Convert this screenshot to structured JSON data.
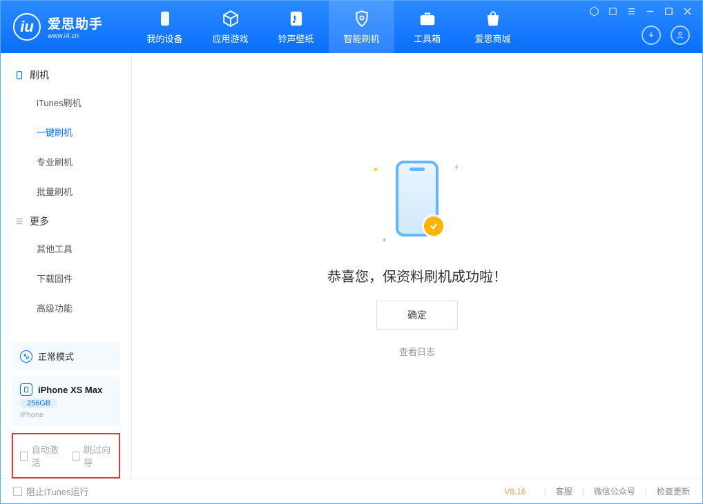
{
  "brand": {
    "name": "爱思助手",
    "url": "www.i4.cn"
  },
  "tabs": [
    {
      "label": "我的设备",
      "icon": "phone"
    },
    {
      "label": "应用游戏",
      "icon": "cube"
    },
    {
      "label": "铃声壁纸",
      "icon": "note"
    },
    {
      "label": "智能刷机",
      "icon": "shield"
    },
    {
      "label": "工具箱",
      "icon": "case"
    },
    {
      "label": "爱思商城",
      "icon": "bag"
    }
  ],
  "activeTabIndex": 3,
  "sidebar": {
    "groups": [
      {
        "title": "刷机",
        "items": [
          "iTunes刷机",
          "一键刷机",
          "专业刷机",
          "批量刷机"
        ],
        "activeIndex": 1
      },
      {
        "title": "更多",
        "items": [
          "其他工具",
          "下载固件",
          "高级功能"
        ],
        "activeIndex": -1
      }
    ],
    "modeCard": {
      "label": "正常模式"
    },
    "deviceCard": {
      "name": "iPhone XS Max",
      "storage": "256GB",
      "type": "iPhone"
    },
    "checks": {
      "autoActivate": "自动激活",
      "skipGuide": "跳过向导"
    }
  },
  "main": {
    "title": "恭喜您，保资料刷机成功啦！",
    "okButton": "确定",
    "viewLog": "查看日志"
  },
  "footer": {
    "blockItunes": "阻止iTunes运行",
    "version": "V8.16",
    "links": [
      "客服",
      "微信公众号",
      "检查更新"
    ]
  }
}
